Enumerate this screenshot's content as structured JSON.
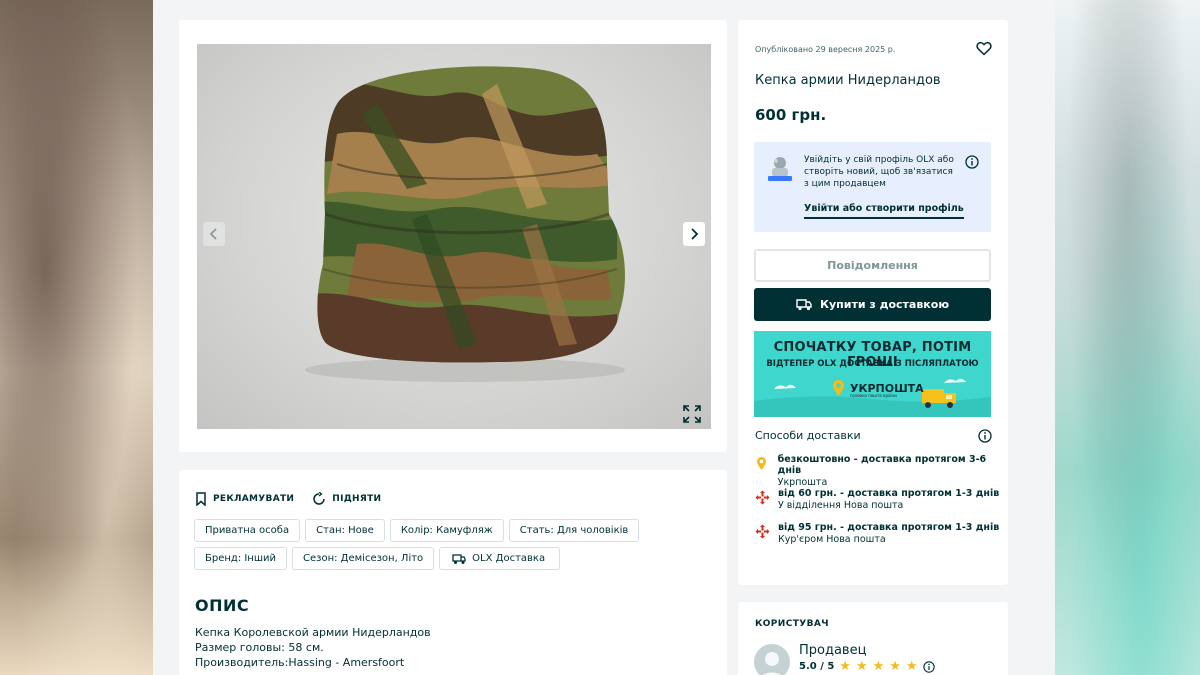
{
  "listing": {
    "published": "Опубліковано 29 вересня 2025 р.",
    "title": "Кепка армии Нидерландов",
    "price": "600 грн."
  },
  "login_prompt": {
    "text": "Увійдіть у свій профіль OLX або створіть новий, щоб зв'язатися з цим продавцем",
    "link": "Увійти або створити профіль"
  },
  "buttons": {
    "message": "Повідомлення",
    "buy": "Купити з доставкою"
  },
  "banner": {
    "headline": "СПОЧАТКУ ТОВАР, ПОТІМ ГРОШІ",
    "subline": "ВІДТЕПЕР OLX ДОСТАВКА З ПІСЛЯПЛАТОЮ",
    "logo": "УКРПОШТА",
    "logo_sub": "головна пошта країни"
  },
  "delivery": {
    "title": "Способи доставки",
    "options": [
      {
        "main": "безкоштовно - доставка протягом 3-6 днів",
        "sub": "Укрпошта",
        "icon": "ukrposhta-pin-icon"
      },
      {
        "main": "від 60 грн. - доставка протягом 1-3 днів",
        "sub": "У відділення Нова пошта",
        "icon": "nova-poshta-icon"
      },
      {
        "main": "від 95 грн. - доставка протягом 1-3 днів",
        "sub": "Кур'єром Нова пошта",
        "icon": "nova-poshta-icon"
      }
    ]
  },
  "actions": {
    "promote": "РЕКЛАМУВАТИ",
    "raise": "ПІДНЯТИ"
  },
  "tags": [
    "Приватна особа",
    "Стан: Нове",
    "Колір: Камуфляж",
    "Стать: Для чоловіків",
    "Бренд: Інший",
    "Сезон: Демісезон, Літо",
    "OLX Доставка"
  ],
  "description": {
    "title": "ОПИС",
    "lines": [
      "Кепка Королевской армии Нидерландов",
      "Размер головы: 58 см.",
      "Производитель:Hassing - Amersfoort"
    ]
  },
  "user": {
    "heading": "КОРИСТУВАЧ",
    "name": "Продавец",
    "rating": "5.0 / 5",
    "stars": 5
  },
  "colors": {
    "brand_dark": "#002f34",
    "banner_bg": "#3ed6cd",
    "login_bg": "#e7efff",
    "star": "#f4bc1b",
    "nova_poshta": "#da291c",
    "ukrposhta": "#f4bc1b"
  }
}
